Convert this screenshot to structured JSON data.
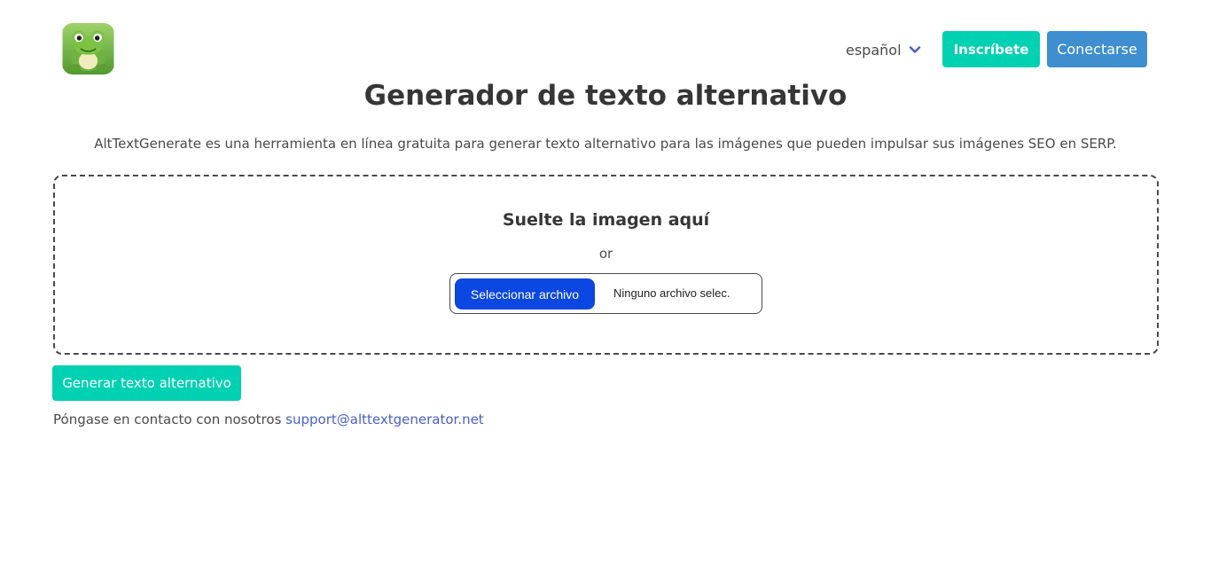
{
  "header": {
    "logo_icon": "frog-icon",
    "language_label": "español",
    "signup_label": "Inscríbete",
    "login_label": "Conectarse"
  },
  "main": {
    "title": "Generador de texto alternativo",
    "subtitle": "AltTextGenerate es una herramienta en línea gratuita para generar texto alternativo para las imágenes que pueden impulsar sus imágenes SEO en SERP.",
    "dropzone": {
      "title": "Suelte la imagen aquí",
      "or_text": "or",
      "file_button_label": "Seleccionar archivo",
      "file_status": "Ninguno archivo selec."
    },
    "generate_label": "Generar texto alternativo",
    "contact_text": "Póngase en contacto con nosotros",
    "contact_email": "support@alttextgenerator.net"
  },
  "colors": {
    "primary": "#00d1b2",
    "info": "#3e8ed0",
    "file_button": "#0b47e0",
    "link": "#485fc7"
  }
}
